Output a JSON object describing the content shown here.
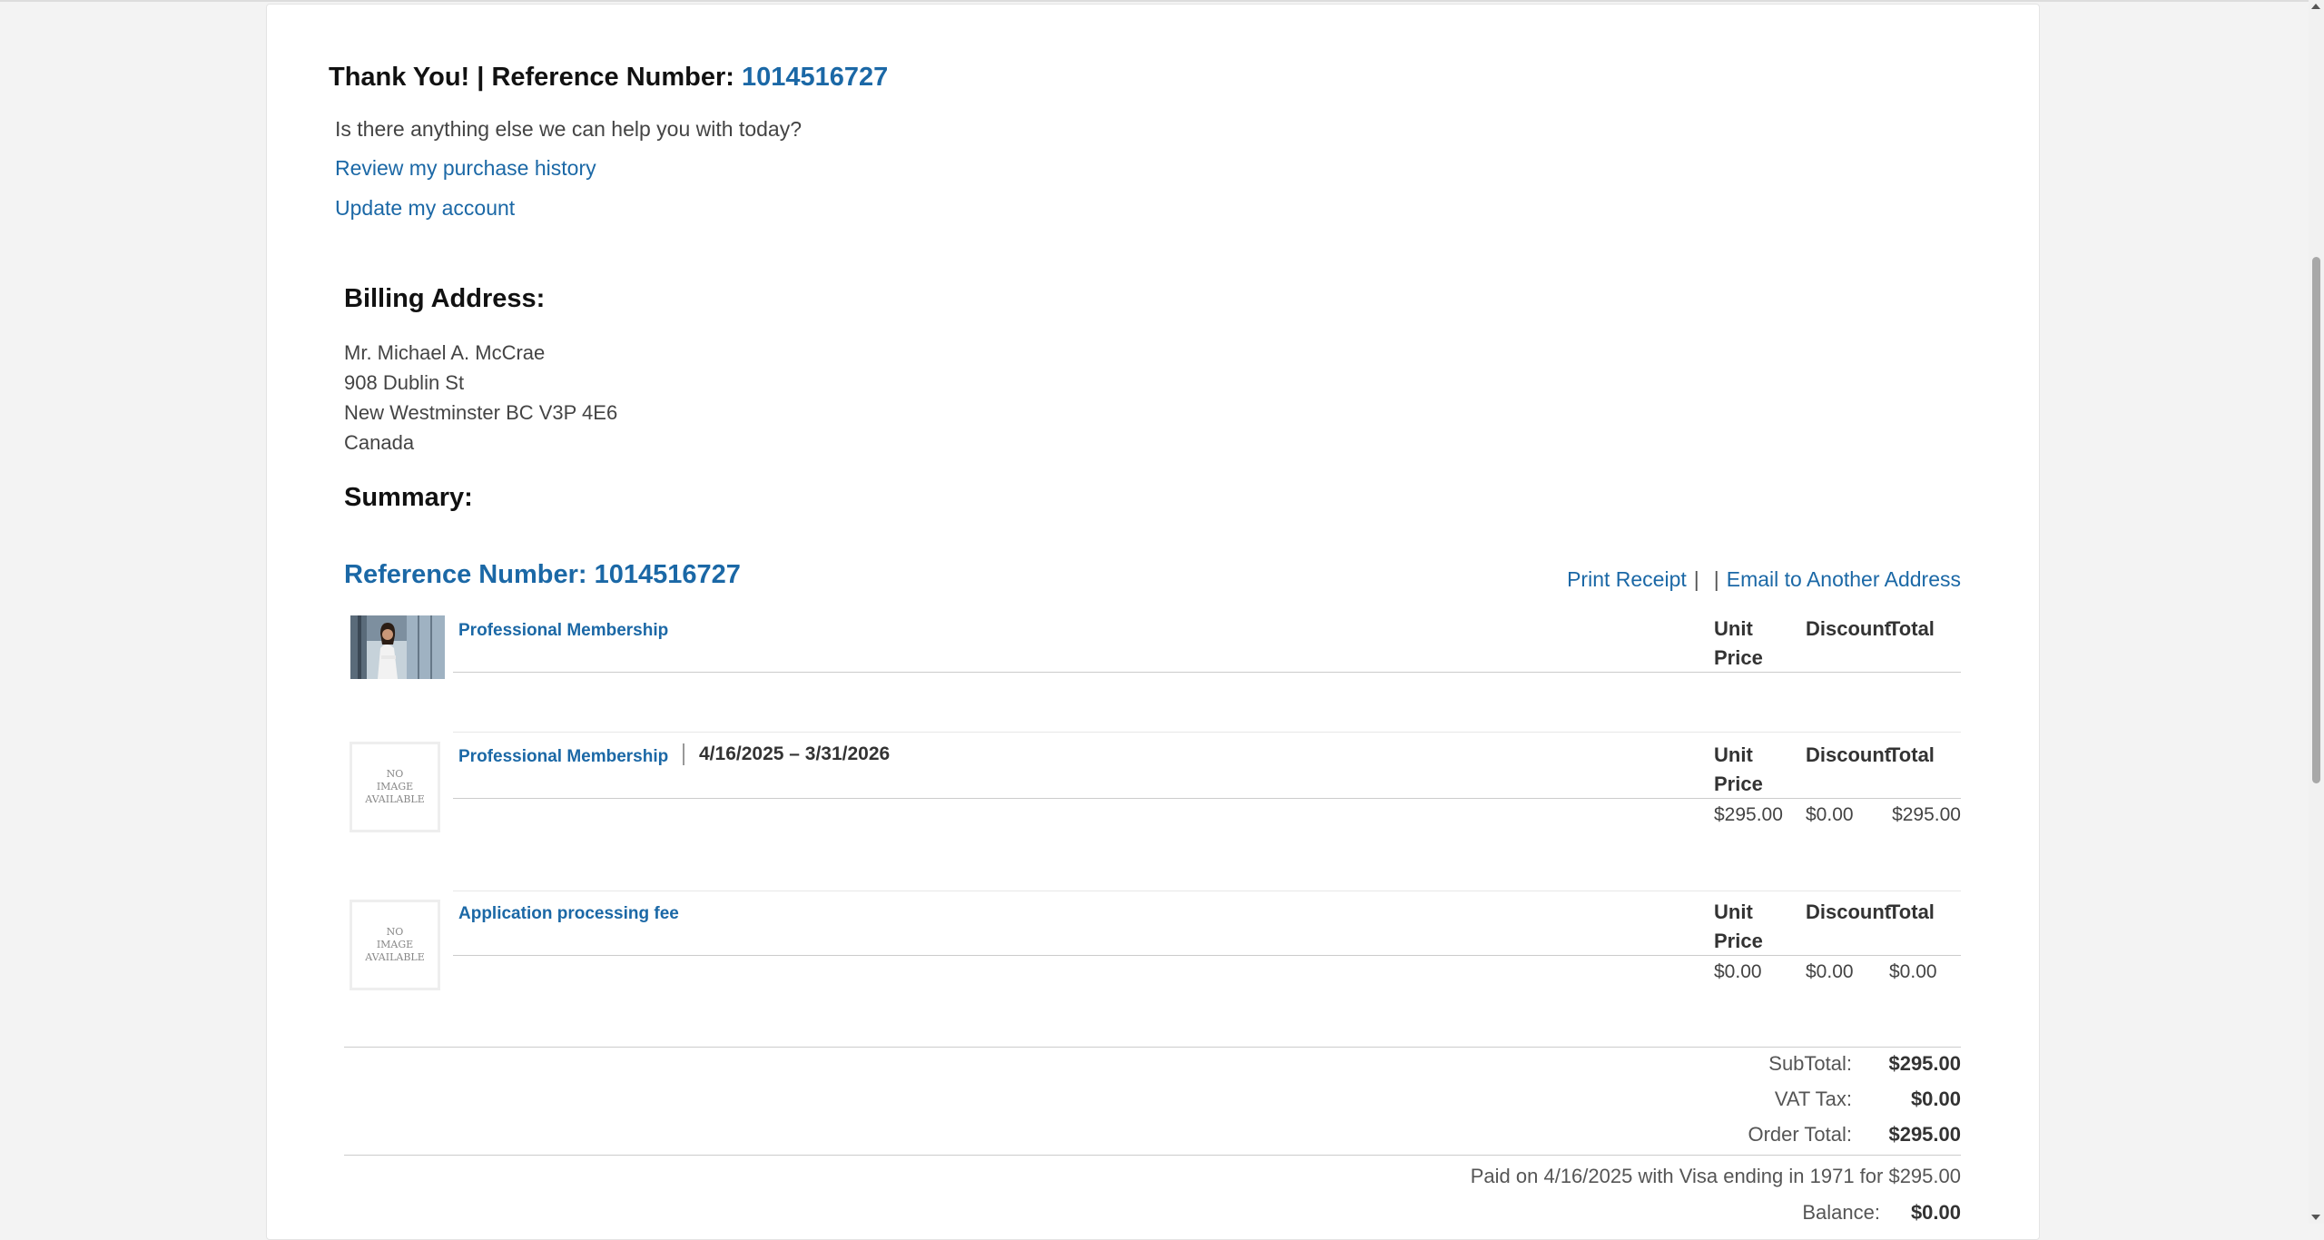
{
  "header": {
    "thanks_prefix": "Thank You! | Reference Number: ",
    "reference_number": "1014516727"
  },
  "help": {
    "question": "Is there anything else we can help you with today?",
    "links": [
      "Review my purchase history",
      "Update my account"
    ]
  },
  "billing": {
    "title": "Billing Address:",
    "lines": [
      "Mr. Michael A. McCrae",
      "908 Dublin St",
      "New Westminster BC V3P 4E6",
      "Canada"
    ]
  },
  "summary": {
    "title": "Summary:",
    "reference_label": "Reference Number: 1014516727",
    "print_receipt": "Print Receipt",
    "separator": "|",
    "email_link": "Email to Another Address"
  },
  "columns": {
    "unit_price": "Unit Price",
    "unit_price_l1": "Unit",
    "unit_price_l2": "Price",
    "discount": "Discount",
    "total": "Total"
  },
  "no_image": {
    "l1": "NO",
    "l2": "IMAGE",
    "l3": "AVAILABLE"
  },
  "items": [
    {
      "name": "Professional Membership",
      "date_range": "",
      "unit_price": "",
      "discount": "",
      "total": ""
    },
    {
      "name": "Professional Membership",
      "date_range": "4/16/2025 – 3/31/2026",
      "unit_price": "$295.00",
      "discount": "$0.00",
      "total": "$295.00"
    },
    {
      "name": "Application processing fee",
      "date_range": "",
      "unit_price": "$0.00",
      "discount": "$0.00",
      "total": "$0.00"
    }
  ],
  "totals": {
    "subtotal_label": "SubTotal:",
    "subtotal": "$295.00",
    "vat_label": "VAT Tax:",
    "vat": "$0.00",
    "order_total_label": "Order Total:",
    "order_total": "$295.00",
    "paid_note": "Paid on 4/16/2025 with Visa ending in 1971 for $295.00",
    "balance_label": "Balance:",
    "balance": "$0.00"
  }
}
